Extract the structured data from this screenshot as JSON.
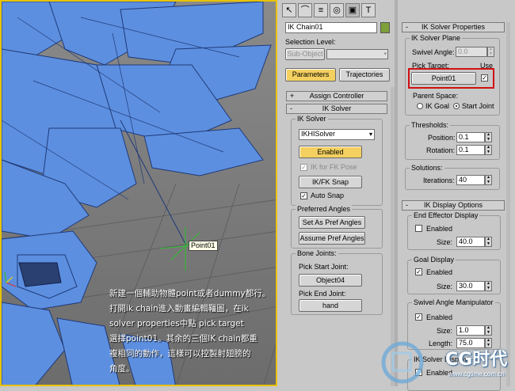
{
  "viewport": {
    "helper_label": "Point01",
    "caption_lines": [
      "新建一個輔助物體point或者dummy都行。",
      "打開ik chain進入動畫編輯韁圖，在ik",
      "solver properties中點 pick target",
      "選擇point01。其余的三個IK chain都重",
      "複相同的動作，這樣可以控製射翅膀的",
      "角度。"
    ]
  },
  "tabs": [
    {
      "icon": "arrow-select-icon",
      "glyph": "↖"
    },
    {
      "icon": "modify-curve-icon",
      "glyph": "⌒"
    },
    {
      "icon": "hierarchy-icon",
      "glyph": "≡"
    },
    {
      "icon": "motion-icon",
      "glyph": "◎"
    },
    {
      "icon": "display-icon",
      "glyph": "▣"
    },
    {
      "icon": "utilities-icon",
      "glyph": "T"
    }
  ],
  "left_panel": {
    "object_name": "IK Chain01",
    "object_color": "#7ea03a",
    "selection_level_label": "Selection Level:",
    "selection_level_value": "Sub-Object",
    "parameters_button": "Parameters",
    "trajectories_button": "Trajectories",
    "assign_controller": "Assign Controller",
    "ik_solver_rollout": "IK Solver",
    "ik_solver_group": "IK Solver",
    "solver_dropdown": "IKHISolver",
    "enabled_button": "Enabled",
    "ik_for_fk_pose": "IK for FK Pose",
    "ik_fk_snap": "IK/FK Snap",
    "auto_snap": "Auto Snap",
    "preferred_angles_group": "Preferred Angles",
    "set_as_pref_angles": "Set As Pref Angles",
    "assume_pref_angles": "Assume Pref Angles",
    "bone_joints_group": "Bone Joints:",
    "pick_start_joint": "Pick Start Joint:",
    "start_joint_value": "Object04",
    "pick_end_joint": "Pick End Joint:",
    "end_joint_value": "hand"
  },
  "right_panel": {
    "ik_solver_properties": "IK Solver Properties",
    "ik_solver_plane_group": "IK Solver Plane",
    "swivel_angle_label": "Swivel Angle:",
    "swivel_angle_value": "0.0",
    "pick_target_label": "Pick Target:",
    "use_label": "Use",
    "target_button": "Point01",
    "parent_space_group": "Parent Space:",
    "ik_goal_option": "IK Goal",
    "start_joint_option": "Start Joint",
    "thresholds_group": "Thresholds:",
    "position_label": "Position:",
    "position_value": "0.1",
    "rotation_label": "Rotation:",
    "rotation_value": "0.1",
    "solutions_group": "Solutions:",
    "iterations_label": "Iterations:",
    "iterations_value": "40",
    "ik_display_options": "IK Display Options",
    "end_effector_display_group": "End Effector Display",
    "ee_enabled": "Enabled",
    "ee_size_label": "Size:",
    "ee_size_value": "40.0",
    "goal_display_group": "Goal Display",
    "goal_enabled": "Enabled",
    "goal_size_label": "Size:",
    "goal_size_value": "30.0",
    "swivel_manip_group": "Swivel Angle Manipulator",
    "swivel_enabled": "Enabled",
    "swivel_size_label": "Size:",
    "swivel_size_value": "1.0",
    "swivel_length_label": "Length:",
    "swivel_length_value": "75.0",
    "ik_solver_display_group": "IK Solver Display",
    "solver_display_enabled": "Enabled"
  },
  "watermark": {
    "brand_cn": "CG时代",
    "url": "www.cgtime.com.cn"
  },
  "colors": {
    "viewport_border": "#e8c300",
    "enabled_button": "#f4d060",
    "highlight_box": "#d01010",
    "mesh_blue": "#5d8fe0"
  }
}
